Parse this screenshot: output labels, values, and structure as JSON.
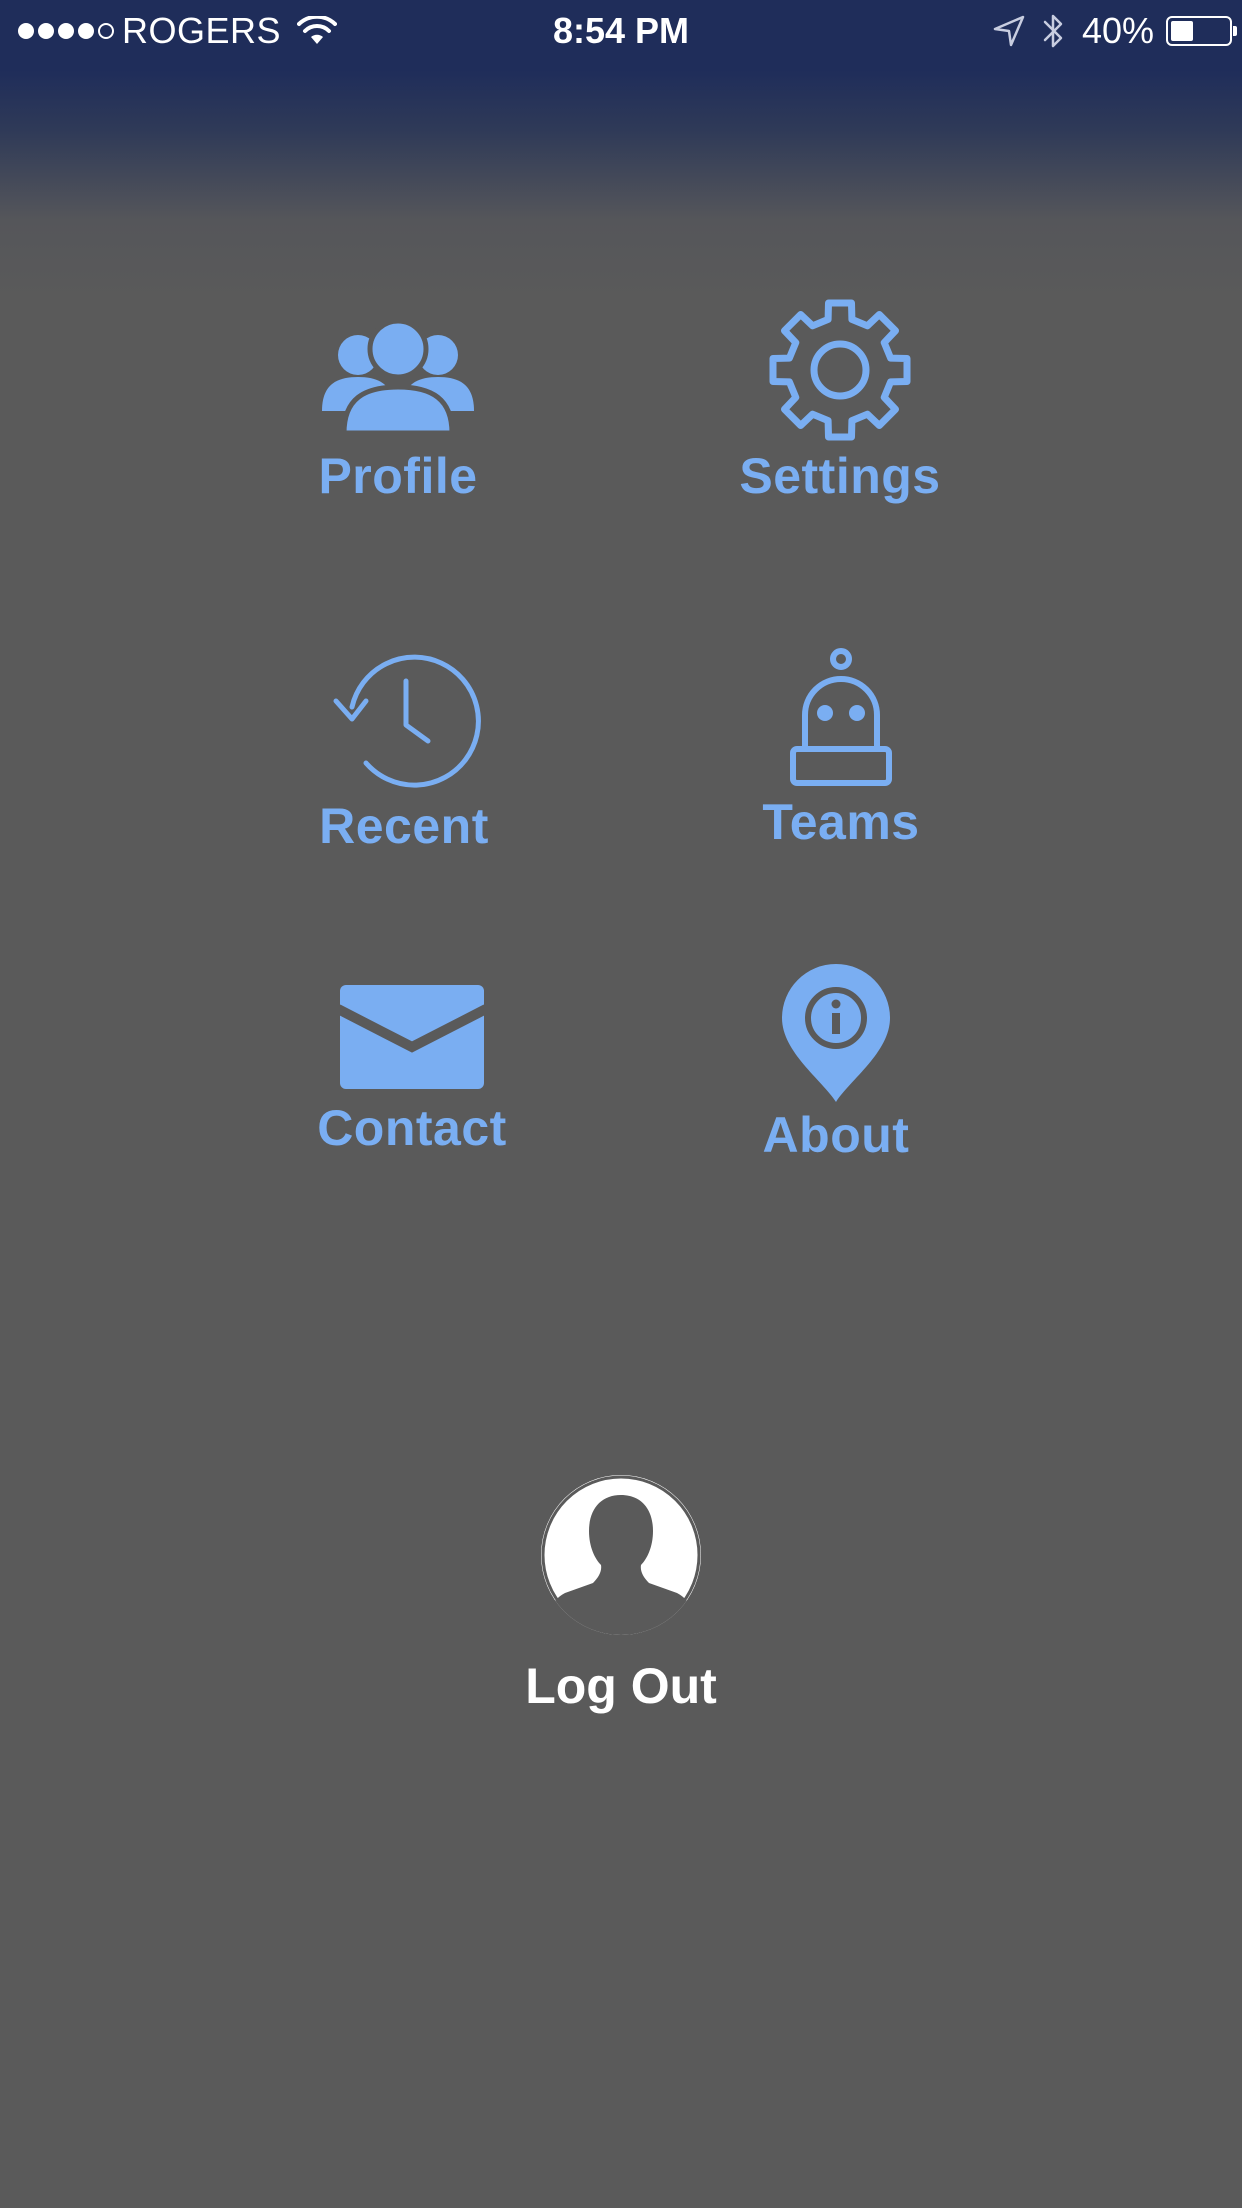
{
  "status_bar": {
    "carrier": "ROGERS",
    "time": "8:54 PM",
    "battery_percent": "40%",
    "battery_level": 0.4,
    "signal_bars": 4,
    "signal_max": 5
  },
  "menu": {
    "profile": {
      "label": "Profile",
      "icon": "people-icon"
    },
    "settings": {
      "label": "Settings",
      "icon": "gear-icon"
    },
    "recent": {
      "label": "Recent",
      "icon": "history-icon"
    },
    "teams": {
      "label": "Teams",
      "icon": "robot-icon"
    },
    "contact": {
      "label": "Contact",
      "icon": "envelope-icon"
    },
    "about": {
      "label": "About",
      "icon": "info-pin-icon"
    }
  },
  "logout": {
    "label": "Log Out",
    "icon": "user-avatar-icon"
  },
  "colors": {
    "accent": "#7aaef2",
    "background": "#5a5a5a",
    "status_bar": "#1f2d5a",
    "text_light": "#ffffff"
  }
}
